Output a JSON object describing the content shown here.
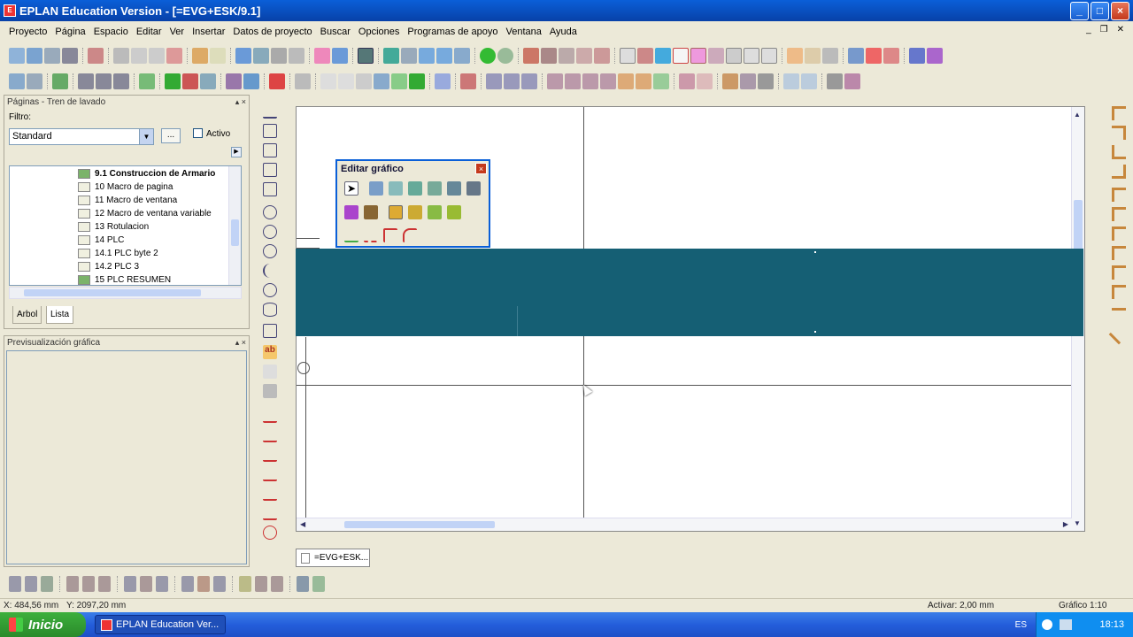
{
  "window": {
    "title": "EPLAN Education Version - [=EVG+ESK/9.1]",
    "minimize": "_",
    "maximize": "□",
    "close": "×"
  },
  "menu": [
    "Proyecto",
    "Página",
    "Espacio",
    "Editar",
    "Ver",
    "Insertar",
    "Datos de proyecto",
    "Buscar",
    "Opciones",
    "Programas de apoyo",
    "Ventana",
    "Ayuda"
  ],
  "pages_panel": {
    "title": "Páginas - Tren de lavado",
    "filter_label": "Filtro:",
    "filter_value": "Standard",
    "browse_label": "...",
    "active_label": "Activo",
    "items": [
      {
        "label": "9.1 Construccion de Armario",
        "bold": true,
        "color": "green"
      },
      {
        "label": "10 Macro de pagina"
      },
      {
        "label": "11 Macro de ventana"
      },
      {
        "label": "12 Macro de ventana variable"
      },
      {
        "label": "13 Rotulacion"
      },
      {
        "label": "14 PLC"
      },
      {
        "label": "14.1 PLC byte 2"
      },
      {
        "label": "14.2 PLC 3"
      },
      {
        "label": "15 PLC RESUMEN",
        "color": "green"
      }
    ],
    "tabs": [
      "Arbol",
      "Lista"
    ]
  },
  "preview_panel": {
    "title": "Previsualización gráfica"
  },
  "edit_graphic": {
    "title": "Editar gráfico"
  },
  "document_tab": "=EVG+ESK...",
  "status": {
    "x": "X: 484,56 mm",
    "y": "Y: 2097,20 mm",
    "snap": "Activar: 2,00 mm",
    "scale": "Gráfico 1:10"
  },
  "taskbar": {
    "start": "Inicio",
    "task": "EPLAN Education Ver...",
    "lang": "ES",
    "clock": "18:13"
  },
  "colors": {
    "band": "#155f74",
    "titlebar": "#0a5fd8",
    "taskbar": "#245edb"
  }
}
